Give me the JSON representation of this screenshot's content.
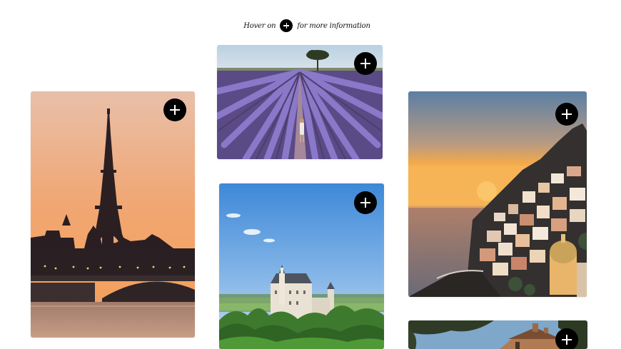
{
  "hint": {
    "prefix": "Hover on",
    "suffix": "for more information",
    "icon": "plus-icon"
  },
  "gallery": {
    "cards": [
      {
        "id": "paris",
        "subject": "Eiffel Tower at sunset",
        "button_icon": "plus-icon"
      },
      {
        "id": "lavender",
        "subject": "Lavender field with tree",
        "button_icon": "plus-icon"
      },
      {
        "id": "castle",
        "subject": "Castle among forest",
        "button_icon": "plus-icon"
      },
      {
        "id": "positano",
        "subject": "Cliffside coastal town at sunset",
        "button_icon": "plus-icon"
      },
      {
        "id": "house",
        "subject": "Stone house under trees",
        "button_icon": "plus-icon"
      }
    ]
  },
  "colors": {
    "button_bg": "#000000",
    "button_icon": "#ffffff",
    "page_bg": "#ffffff"
  }
}
